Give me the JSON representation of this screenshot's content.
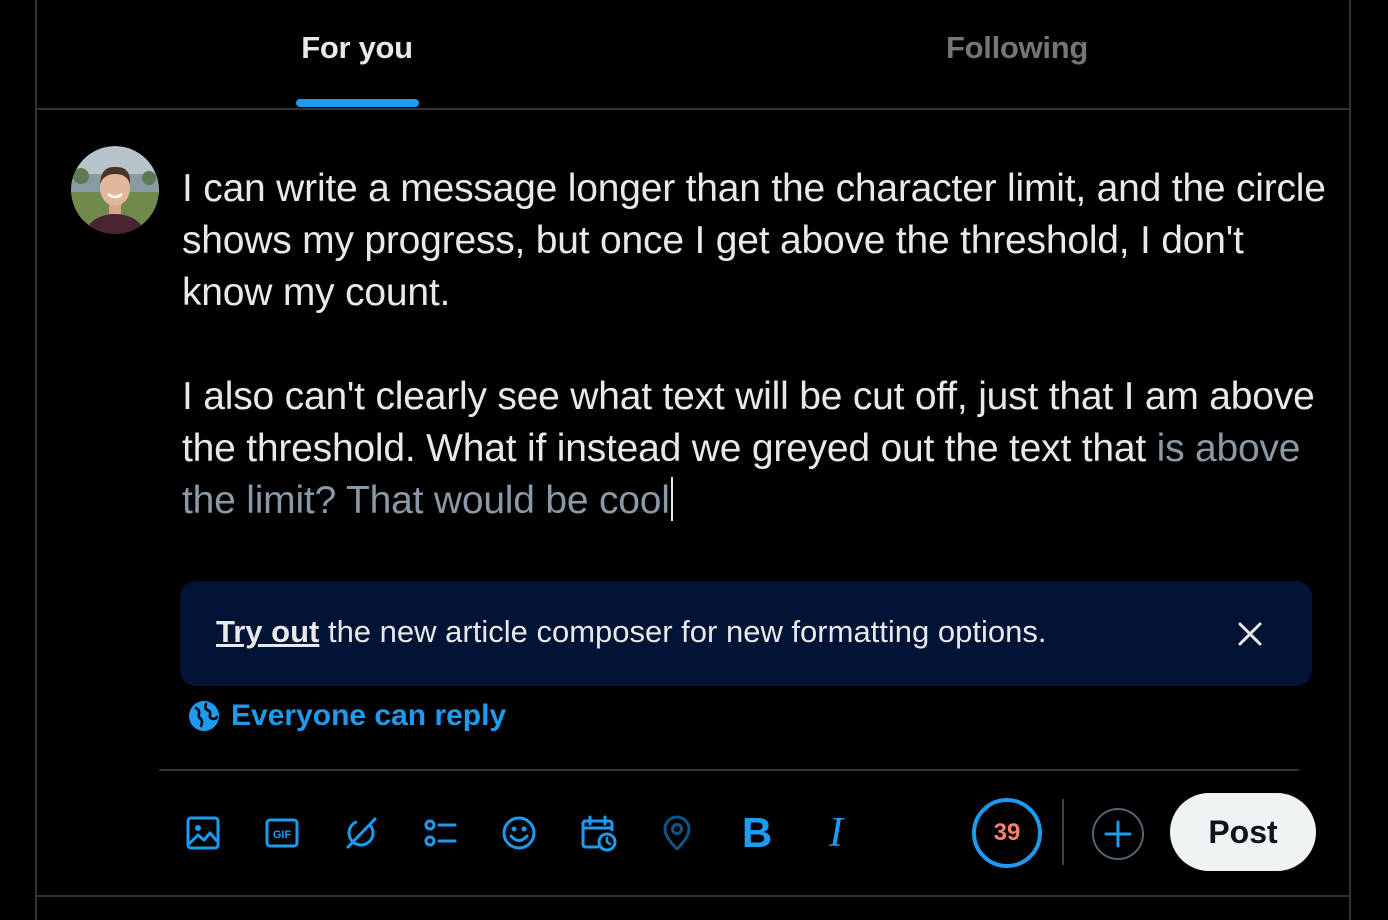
{
  "tabs": [
    {
      "label": "For you",
      "active": true
    },
    {
      "label": "Following",
      "active": false
    }
  ],
  "composer": {
    "paragraph1": "I can write a message longer than the character limit, and the circle shows my progress, but once I get above the threshold, I don't know my count.",
    "paragraph2_within_limit": "I also can't clearly see what text will be cut off, just that I am above the threshold. What if instead we greyed out the text that ",
    "paragraph2_over_limit": "is above the limit? That would be cool"
  },
  "banner": {
    "link_text": "Try out",
    "text": " the new article composer for new formatting options."
  },
  "reply_setting": {
    "label": "Everyone can reply",
    "icon": "globe-icon"
  },
  "toolbar": {
    "icons": [
      "image-icon",
      "gif-icon",
      "grok-icon",
      "poll-icon",
      "emoji-icon",
      "schedule-icon",
      "location-icon",
      "bold-icon",
      "italic-icon"
    ],
    "bold_label": "B",
    "italic_label": "I",
    "char_count": "39",
    "post_label": "Post"
  },
  "colors": {
    "accent": "#1d9bf0",
    "counter_warning": "#f4806d",
    "greyed_text": "#8b98a5",
    "banner_bg": "#031335"
  }
}
